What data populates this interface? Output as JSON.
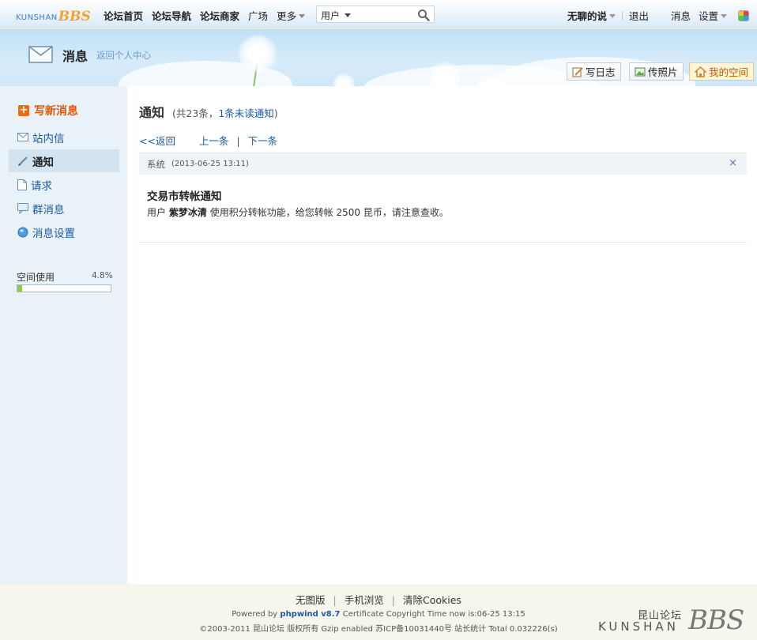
{
  "topbar": {
    "logo_kunshan": "KUNSHAN",
    "logo_bbs": "BBS",
    "nav": [
      "论坛首页",
      "论坛导航",
      "论坛商家",
      "广场",
      "更多"
    ],
    "search_scope": "用户",
    "username": "无聊的说",
    "logout": "退出",
    "messages": "消息",
    "settings": "设置"
  },
  "banner": {
    "title": "消息",
    "back_link": "返回个人中心",
    "buttons": [
      "写日志",
      "传照片",
      "我的空间"
    ]
  },
  "sidebar": {
    "compose": "写新消息",
    "items": [
      {
        "label": "站内信",
        "icon": "envelope-icon"
      },
      {
        "label": "通知",
        "icon": "pencil-icon"
      },
      {
        "label": "请求",
        "icon": "document-icon"
      },
      {
        "label": "群消息",
        "icon": "chat-bubble-icon"
      },
      {
        "label": "消息设置",
        "icon": "globe-icon"
      }
    ],
    "active_index": 1,
    "space_label": "空间使用",
    "space_percent": "4.8%",
    "space_fraction": 0.048
  },
  "main": {
    "title": "通知",
    "count_prefix": "(共23条，",
    "unread_link": "1条未读通知",
    "count_suffix": ")",
    "back": "<<返回",
    "prev": "上一条",
    "next": "下一条",
    "separator": "|",
    "message": {
      "sender": "系统",
      "time": "(2013-06-25 13:11)",
      "close": "×",
      "title": "交易市转帐通知",
      "body_prefix": "用户",
      "body_user": "紫梦冰清",
      "body_suffix": "使用积分转帐功能，给您转帐 2500 昆币，请注意查收。"
    }
  },
  "footer": {
    "links": [
      "无图版",
      "手机浏览",
      "清除Cookies"
    ],
    "powered_prefix": "Powered by",
    "powered_link": "phpwind v8.7",
    "powered_suffix": "Certificate Copyright Time now is:06-25 13:15",
    "copyright": "©2003-2011 昆山论坛 版权所有 Gzip enabled 苏ICP备10031440号 站长统计 Total 0.032226(s)",
    "logo_cn": "昆山论坛",
    "logo_en": "KUNSHAN",
    "logo_bbs": "BBS"
  }
}
